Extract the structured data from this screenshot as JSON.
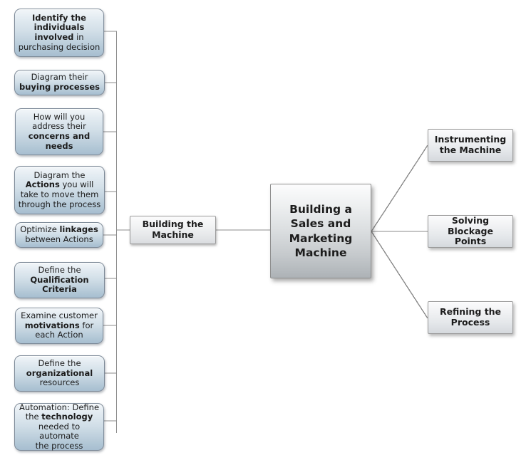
{
  "diagram": {
    "title": "Building a Sales and Marketing Machine",
    "background_color": "#ffffff",
    "edge_color": "#8b8b8b",
    "leaf_fill_top": "#f2f6f9",
    "leaf_fill_bottom": "#a7bed0",
    "leaf_border": "#7e8b99",
    "node_fill_top": "#fcfcfd",
    "node_fill_bottom": "#adb2b6",
    "node_border": "#8e8e8e",
    "text_color": "#1c1c1c"
  },
  "root": {
    "label": "Building a\nSales and\nMarketing\nMachine"
  },
  "mid_node": {
    "label": "Building the\nMachine"
  },
  "left_branch": {
    "items": [
      {
        "line1": "Identify the",
        "line1_bold": true,
        "line2": "individuals",
        "line2_bold": true,
        "line3_bold": "involved",
        "line3_rest": " in",
        "line4": "purchasing decision",
        "line4_bold": false,
        "plain": "Identify the individuals involved in purchasing decision"
      },
      {
        "line1": "Diagram their",
        "line1_bold": false,
        "line2": "buying processes",
        "line2_bold": true,
        "plain": "Diagram their buying processes"
      },
      {
        "line1": "How will you",
        "line1_bold": false,
        "line2": "address their",
        "line2_bold": false,
        "line3_bold": "concerns and",
        "line3_rest": "",
        "line4": "needs",
        "line4_bold": true,
        "plain": "How will you address their concerns and needs"
      },
      {
        "line1": "Diagram the",
        "line1_bold": false,
        "line2_bold": "Actions",
        "line2_rest": " you will",
        "line3": "take to move them",
        "line3_bold": false,
        "line4": "through the process",
        "line4_bold": false,
        "plain": "Diagram the Actions you will take to move them through the process"
      },
      {
        "line1_pre": "Optimize ",
        "line1_bold": "linkages",
        "line2": "between Actions",
        "line2_bold": false,
        "plain": "Optimize linkages between Actions"
      },
      {
        "line1": "Define the",
        "line1_bold": false,
        "line2": "Qualification",
        "line2_bold": true,
        "line3": "Criteria",
        "line3_bold": true,
        "plain": "Define the Qualification Criteria"
      },
      {
        "line1": "Examine customer",
        "line1_bold": false,
        "line2_bold": "motivations",
        "line2_rest": " for",
        "line3": "each Action",
        "line3_bold": false,
        "plain": "Examine customer motivations for each Action"
      },
      {
        "line1": "Define the",
        "line1_bold": false,
        "line2": "organizational",
        "line2_bold": true,
        "line3": "resources",
        "line3_bold": false,
        "plain": "Define the organizational resources"
      },
      {
        "line1": "Automation: Define",
        "line1_bold": false,
        "line2_pre": "the ",
        "line2_bold": "technology",
        "line3": "needed to automate",
        "line3_bold": false,
        "line4": "the process",
        "line4_bold": false,
        "plain": "Automation: Define the technology needed to automate the process"
      }
    ]
  },
  "right_branch": {
    "items": [
      {
        "label": "Instrumenting\nthe Machine"
      },
      {
        "label": "Solving Blockage\nPoints"
      },
      {
        "label": "Refining the\nProcess"
      }
    ]
  }
}
